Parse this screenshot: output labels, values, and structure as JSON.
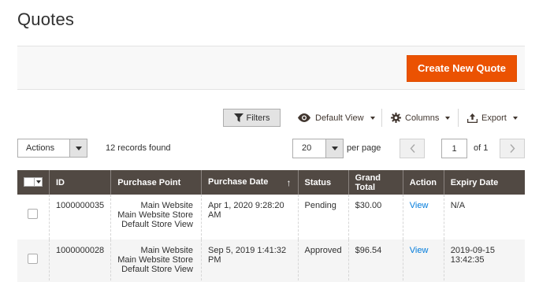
{
  "page": {
    "title": "Quotes"
  },
  "actionbar": {
    "create_label": "Create New Quote"
  },
  "toolbar": {
    "filters_label": "Filters",
    "view_label": "Default View",
    "columns_label": "Columns",
    "export_label": "Export"
  },
  "grid_controls": {
    "actions_label": "Actions",
    "records_found": "12 records found",
    "per_page_value": "20",
    "per_page_label": "per page",
    "current_page": "1",
    "of_pages": "of 1",
    "prev_icon": "chevron-left-icon",
    "next_icon": "chevron-right-icon"
  },
  "table": {
    "headers": {
      "id": "ID",
      "purchase_point": "Purchase Point",
      "purchase_date": "Purchase Date",
      "status": "Status",
      "grand_total": "Grand Total",
      "action": "Action",
      "expiry_date": "Expiry Date"
    },
    "sort_indicator": "↑",
    "rows": [
      {
        "id": "1000000035",
        "pp1": "Main Website",
        "pp2": "Main Website Store",
        "pp3": "Default Store View",
        "purchase_date": "Apr 1, 2020 9:28:20 AM",
        "status": "Pending",
        "grand_total": "$30.00",
        "action": "View",
        "expiry_date": "N/A"
      },
      {
        "id": "1000000028",
        "pp1": "Main Website",
        "pp2": "Main Website Store",
        "pp3": "Default Store View",
        "purchase_date": "Sep 5, 2019 1:41:32 PM",
        "status": "Approved",
        "grand_total": "$96.54",
        "action": "View",
        "expiry_date": "2019-09-15 13:42:35"
      }
    ]
  },
  "colors": {
    "accent": "#eb5202",
    "header_bg": "#514943",
    "link": "#007bdb"
  }
}
